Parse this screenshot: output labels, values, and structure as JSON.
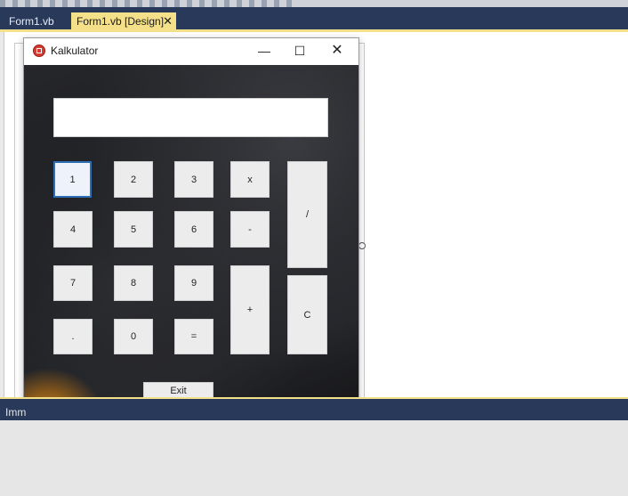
{
  "ide": {
    "tabs": [
      {
        "label": "Form1.vb"
      },
      {
        "label": "Form1.vb [Design]"
      }
    ],
    "bottom_panel_label": "Imm"
  },
  "form": {
    "title": "Kalkulator",
    "display_value": "",
    "keys": {
      "k1": "1",
      "k2": "2",
      "k3": "3",
      "multiply": "x",
      "divide": "/",
      "k4": "4",
      "k5": "5",
      "k6": "6",
      "minus": "-",
      "k7": "7",
      "k8": "8",
      "k9": "9",
      "plus": "+",
      "clear": "C",
      "dot": ".",
      "k0": "0",
      "equals": "="
    },
    "exit_label": "Exit"
  },
  "icons": {
    "tab_close": "close-icon",
    "app": "app-icon",
    "minimize": "minimize-icon",
    "maximize": "maximize-icon",
    "close": "close-icon"
  }
}
